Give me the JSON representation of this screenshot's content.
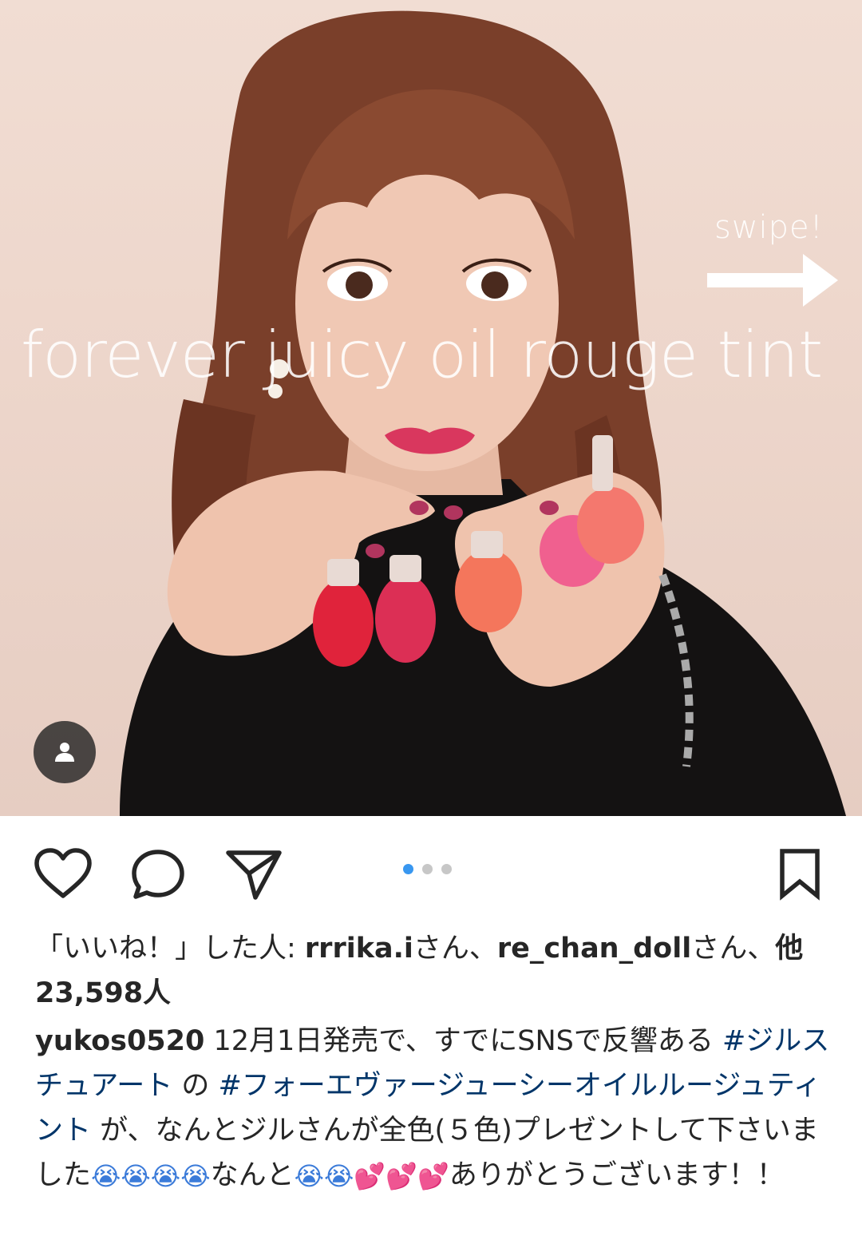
{
  "post": {
    "image_overlay_title": "forever juicy oil rouge tint",
    "image_overlay_swipe": "swipe!",
    "carousel": {
      "count": 3,
      "active_index": 0
    }
  },
  "icons": {
    "like": "heart-icon",
    "comment": "comment-bubble-icon",
    "share": "paper-plane-icon",
    "save": "bookmark-icon",
    "tag": "user-tag-icon",
    "swipe": "right-arrow-icon"
  },
  "likes": {
    "prefix": "「いいね！」した人: ",
    "user1": "rrrika.i",
    "sep1": "さん、",
    "user2": "re_chan_doll",
    "sep2": "さん、",
    "others": "他23,598人"
  },
  "caption": {
    "username": "yukos0520",
    "text1": " 12月1日発売で、すでにSNSで反響ある ",
    "hashtag1": "#ジルスチュアート",
    "text2": " の ",
    "hashtag2": "#フォーエヴァージューシーオイルルージュティント",
    "text3": " が、なんとジルさんが全色(５色)プレゼントして下さいました",
    "emoji_cry": "😭",
    "text4": "なんと",
    "emoji_heart": "💕",
    "text5": "ありがとうございます！！"
  },
  "colors": {
    "accent_blue": "#3897f0",
    "hashtag": "#003569",
    "text": "#262626"
  }
}
